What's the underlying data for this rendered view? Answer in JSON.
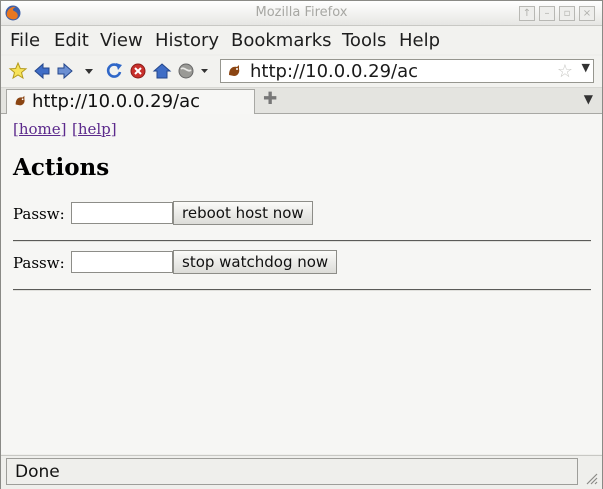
{
  "window": {
    "title": "Mozilla Firefox"
  },
  "menu": [
    "File",
    "Edit",
    "View",
    "History",
    "Bookmarks",
    "Tools",
    "Help"
  ],
  "toolbar": {
    "url": "http://10.0.0.29/ac",
    "icons": [
      "new-bookmark-icon",
      "back-icon",
      "forward-icon",
      "history-dropdown-icon",
      "reload-icon",
      "stop-icon",
      "home-icon",
      "globe-icon"
    ]
  },
  "tab": {
    "title": "http://10.0.0.29/ac"
  },
  "page": {
    "links": [
      "[home]",
      "[help]"
    ],
    "heading": "Actions",
    "forms": [
      {
        "label": "Passw:",
        "button": "reboot host now"
      },
      {
        "label": "Passw:",
        "button": "stop watchdog now"
      }
    ]
  },
  "status": {
    "text": "Done"
  },
  "colors": {
    "link": "#5c2a8c",
    "page_bg": "#f6f6f4",
    "chrome_bg": "#efefec"
  }
}
